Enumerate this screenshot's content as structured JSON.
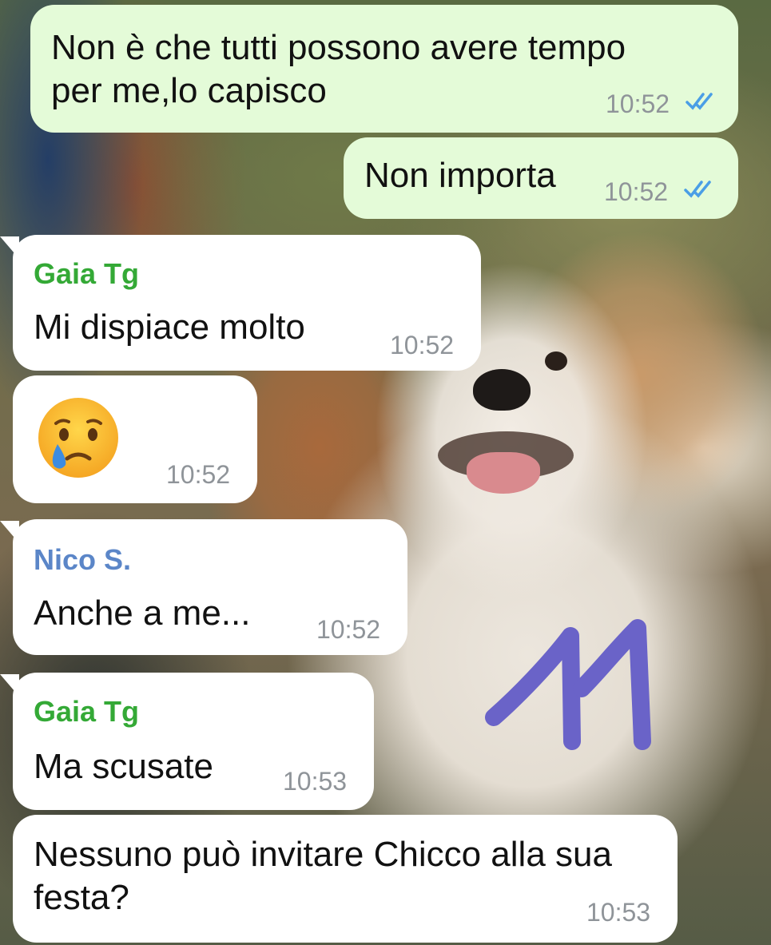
{
  "colors": {
    "outgoing_bubble": "#e4fbd8",
    "incoming_bubble": "#ffffff",
    "sender_gaia": "#34a936",
    "sender_nico": "#5b86c8",
    "timestamp": "#8f9499",
    "read_ticks": "#4a9ee6",
    "scribble": "#6a63c8"
  },
  "overlay": {
    "scribble_icon": "handwritten-11-drawing"
  },
  "messages": [
    {
      "direction": "outgoing",
      "lines": [
        "Non è che tutti possono avere tempo",
        "per me,lo capisco"
      ],
      "time": "10:52",
      "status_icon": "double-check-read-icon"
    },
    {
      "direction": "outgoing",
      "lines": [
        "Non importa"
      ],
      "time": "10:52",
      "status_icon": "double-check-read-icon"
    },
    {
      "direction": "incoming",
      "sender": "Gaia Tg",
      "lines": [
        "Mi dispiace molto"
      ],
      "time": "10:52"
    },
    {
      "direction": "incoming",
      "emoji": "crying-face-emoji",
      "time": "10:52"
    },
    {
      "direction": "incoming",
      "sender": "Nico S.",
      "lines": [
        "Anche a me..."
      ],
      "time": "10:52"
    },
    {
      "direction": "incoming",
      "sender": "Gaia Tg",
      "lines": [
        "Ma scusate"
      ],
      "time": "10:53"
    },
    {
      "direction": "incoming",
      "lines": [
        "Nessuno può invitare Chicco alla sua",
        "festa?"
      ],
      "time": "10:53"
    }
  ]
}
